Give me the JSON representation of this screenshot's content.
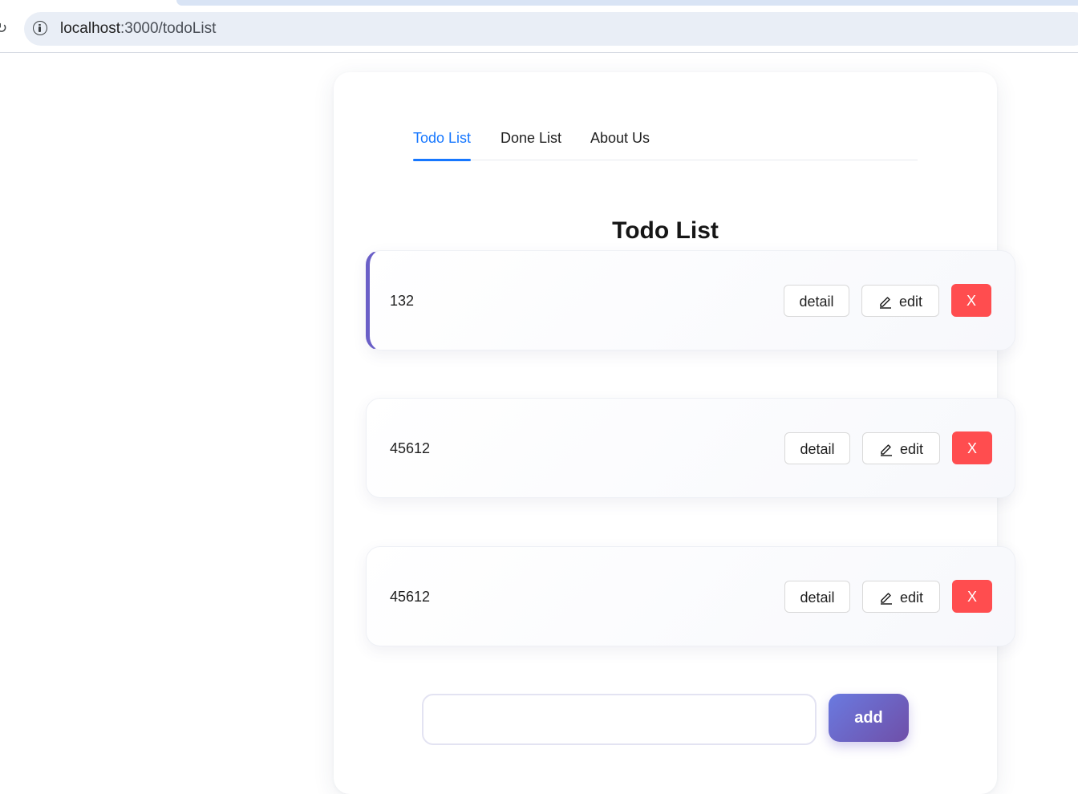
{
  "browser": {
    "url_host": "localhost",
    "url_rest": ":3000/todoList",
    "info_icon": "info-icon",
    "reload_icon": "reload-icon"
  },
  "tabs": [
    {
      "label": "Todo List",
      "active": true
    },
    {
      "label": "Done List",
      "active": false
    },
    {
      "label": "About Us",
      "active": false
    }
  ],
  "page_title": "Todo List",
  "todos": [
    {
      "text": "132",
      "detail_label": "detail",
      "edit_label": "edit",
      "delete_label": "X"
    },
    {
      "text": "45612",
      "detail_label": "detail",
      "edit_label": "edit",
      "delete_label": "X"
    },
    {
      "text": "45612",
      "detail_label": "detail",
      "edit_label": "edit",
      "delete_label": "X"
    }
  ],
  "add_form": {
    "input_value": "",
    "input_placeholder": "",
    "button_label": "add"
  },
  "colors": {
    "accent": "#1677ff",
    "danger": "#ff4d4f",
    "add_gradient_start": "#6a7ae0",
    "add_gradient_end": "#6f4fa8",
    "first_item_marker": "#6a5fc7"
  }
}
